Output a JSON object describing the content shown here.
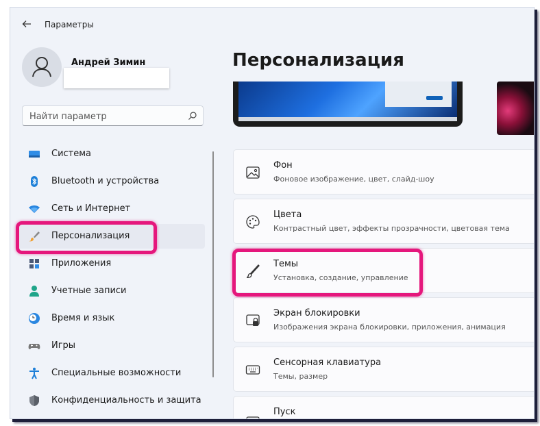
{
  "window": {
    "title": "Параметры"
  },
  "user": {
    "name": "Андрей Зимин"
  },
  "search": {
    "placeholder": "Найти параметр"
  },
  "nav": {
    "items": [
      {
        "label": "Система",
        "icon": "system-icon"
      },
      {
        "label": "Bluetooth и устройства",
        "icon": "bluetooth-icon"
      },
      {
        "label": "Сеть и Интернет",
        "icon": "wifi-icon"
      },
      {
        "label": "Персонализация",
        "icon": "brush-icon",
        "active": true
      },
      {
        "label": "Приложения",
        "icon": "apps-icon"
      },
      {
        "label": "Учетные записи",
        "icon": "accounts-icon"
      },
      {
        "label": "Время и язык",
        "icon": "clock-globe-icon"
      },
      {
        "label": "Игры",
        "icon": "gamepad-icon"
      },
      {
        "label": "Специальные возможности",
        "icon": "accessibility-icon"
      },
      {
        "label": "Конфиденциальность и защита",
        "icon": "shield-icon"
      }
    ]
  },
  "page": {
    "title": "Персонализация"
  },
  "cards": [
    {
      "title": "Фон",
      "subtitle": "Фоновое изображение, цвет, слайд-шоу",
      "icon": "image-icon"
    },
    {
      "title": "Цвета",
      "subtitle": "Контрастный цвет, эффекты прозрачности, цветовая тема",
      "icon": "palette-icon"
    },
    {
      "title": "Темы",
      "subtitle": "Установка, создание, управление",
      "icon": "brush-icon"
    },
    {
      "title": "Экран блокировки",
      "subtitle": "Изображения экрана блокировки, приложения, анимация",
      "icon": "lock-screen-icon"
    },
    {
      "title": "Сенсорная клавиатура",
      "subtitle": "Темы, размер",
      "icon": "keyboard-icon"
    },
    {
      "title": "Пуск",
      "subtitle": "",
      "icon": "start-icon"
    }
  ],
  "colors": {
    "accent": "#1565c0",
    "highlight": "#e5177c"
  }
}
